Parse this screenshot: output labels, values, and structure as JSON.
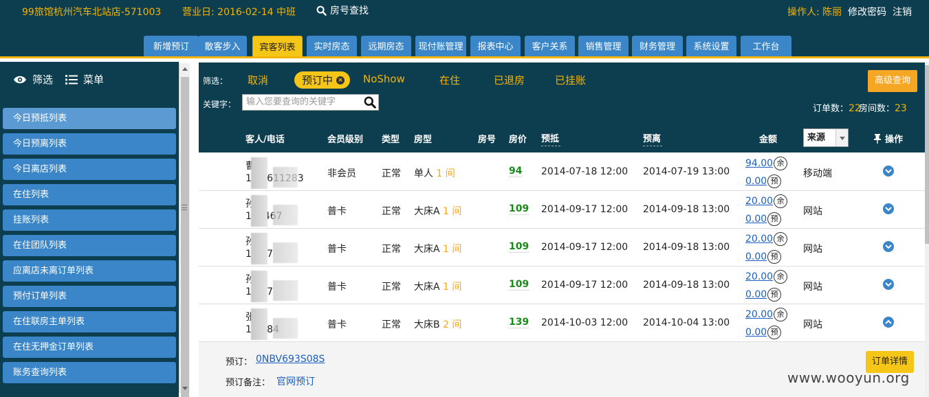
{
  "header": {
    "hotel": "99旅馆杭州汽车北站店-571003",
    "business_date": "营业日: 2016-02-14 中班",
    "room_search": "房号查找",
    "operator_label": "操作人: ",
    "operator_name": "陈丽",
    "change_password": "修改密码",
    "logout": "注销"
  },
  "nav_tabs": [
    "新增预订",
    "散客步入",
    "宾客列表",
    "实时房态",
    "远期房态",
    "现付账管理",
    "报表中心",
    "客户关系",
    "销售管理",
    "财务管理",
    "系统设置",
    "工作台"
  ],
  "active_tab": "宾客列表",
  "sidebar": {
    "filter_label": "筛选",
    "menu_label": "菜单",
    "items": [
      "今日预抵列表",
      "今日预离列表",
      "今日离店列表",
      "在住列表",
      "挂账列表",
      "在住团队列表",
      "应离店未离订单列表",
      "预付订单列表",
      "在住联房主单列表",
      "在住无押金订单列表",
      "账务查询列表"
    ]
  },
  "filter": {
    "label": "筛选：",
    "chips": [
      "取消",
      "预订中",
      "NoShow",
      "在住",
      "已退房",
      "已挂账"
    ],
    "selected": "预订中",
    "keyword_label": "关键字：",
    "keyword_placeholder": "输入您要查询的关键字",
    "advanced_button": "高级查询",
    "order_count_label": "订单数：",
    "order_count": "22",
    "room_count_label": "房间数：",
    "room_count": "23"
  },
  "table": {
    "headers": {
      "guest": "客人/电话",
      "member_level": "会员级别",
      "type": "类型",
      "room_type": "房型",
      "room_no": "房号",
      "price": "房价",
      "arrive": "预抵",
      "depart": "预离",
      "amount": "金额",
      "source": "来源",
      "action": "操作"
    },
    "rows": [
      {
        "name": "曹",
        "phone": "1 82611283",
        "member": "非会员",
        "type": "正常",
        "room_type": "单人",
        "qty": "1 间",
        "price": "94",
        "arrive": "2014-07-18 12:00",
        "depart": "2014-07-19 13:00",
        "balance": "94.00",
        "prepay": "0.00",
        "source": "移动端"
      },
      {
        "name": "孙",
        "phone": "1   7  467",
        "member": "普卡",
        "type": "正常",
        "room_type": "大床A",
        "qty": "1 间",
        "price": "109",
        "arrive": "2014-09-17 12:00",
        "depart": "2014-09-18 13:00",
        "balance": "20.00",
        "prepay": "0.00",
        "source": "网站"
      },
      {
        "name": "孙",
        "phone": "1      467",
        "member": "普卡",
        "type": "正常",
        "room_type": "大床A",
        "qty": "1 间",
        "price": "109",
        "arrive": "2014-09-17 12:00",
        "depart": "2014-09-18 13:00",
        "balance": "20.00",
        "prepay": "0.00",
        "source": "网站"
      },
      {
        "name": "孙",
        "phone": "1      467",
        "member": "普卡",
        "type": "正常",
        "room_type": "大床A",
        "qty": "1 间",
        "price": "109",
        "arrive": "2014-09-17 12:00",
        "depart": "2014-09-18 13:00",
        "balance": "20.00",
        "prepay": "0.00",
        "source": "网站"
      },
      {
        "name": "张",
        "phone": "1      5584",
        "member": "普卡",
        "type": "正常",
        "room_type": "大床B",
        "qty": "2 间",
        "price": "139",
        "arrive": "2014-10-03 12:00",
        "depart": "2014-10-04 13:00",
        "balance": "20.00",
        "prepay": "0.00",
        "source": "网站"
      }
    ],
    "balance_badge": "余",
    "prepay_badge": "预"
  },
  "detail": {
    "order_label": "预订：",
    "order_no": "0NBV693S08S",
    "remark_label": "预订备注：",
    "remark": "官网预订",
    "detail_button": "订单详情"
  },
  "watermark": "www.wooyun.org"
}
